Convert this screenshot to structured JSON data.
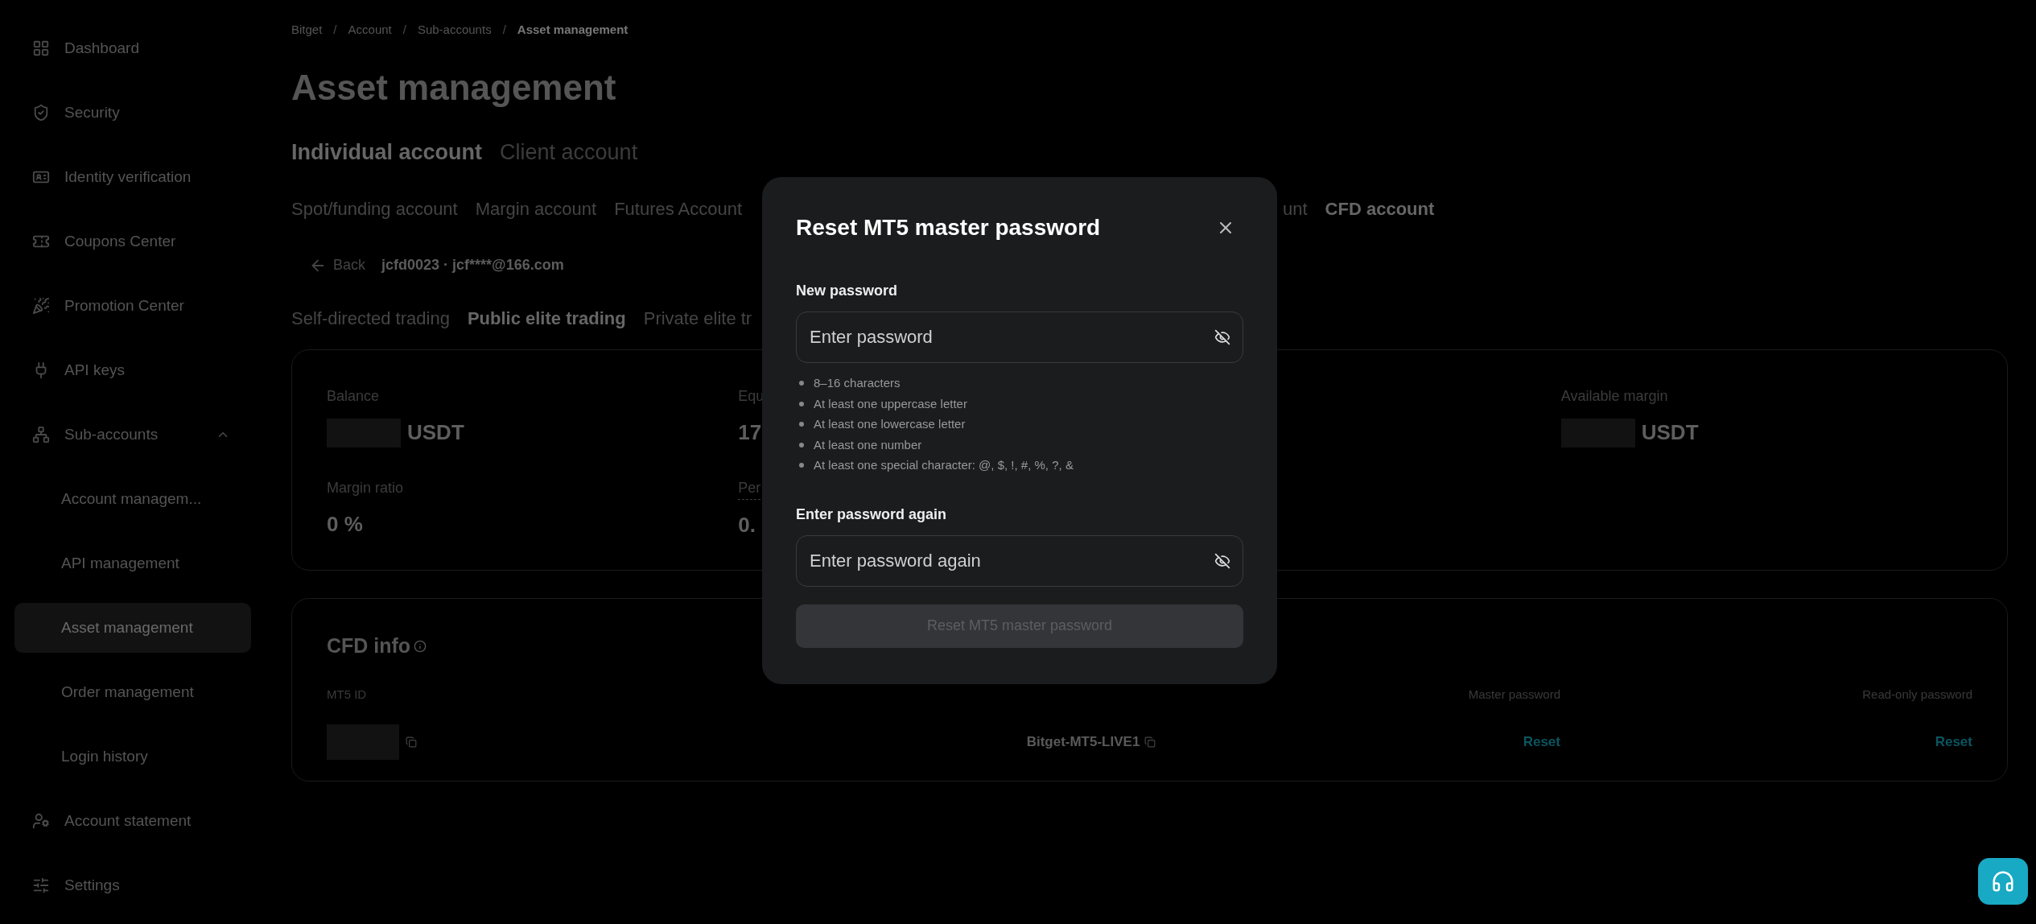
{
  "sidebar": {
    "items": [
      {
        "label": "Dashboard",
        "selected": false
      },
      {
        "label": "Security",
        "selected": false
      },
      {
        "label": "Identity verification",
        "selected": false
      },
      {
        "label": "Coupons Center",
        "selected": false
      },
      {
        "label": "Promotion Center",
        "selected": false
      },
      {
        "label": "API keys",
        "selected": false
      },
      {
        "label": "Sub-accounts",
        "selected": false,
        "expanded": true,
        "children": [
          {
            "label": "Account managem...",
            "selected": false
          },
          {
            "label": "API management",
            "selected": false
          },
          {
            "label": "Asset management",
            "selected": true
          },
          {
            "label": "Order management",
            "selected": false
          },
          {
            "label": "Login history",
            "selected": false
          }
        ]
      },
      {
        "label": "Account statement",
        "selected": false
      },
      {
        "label": "Settings",
        "selected": false
      }
    ]
  },
  "breadcrumb": [
    {
      "label": "Bitget",
      "current": false
    },
    {
      "label": "Account",
      "current": false
    },
    {
      "label": "Sub-accounts",
      "current": false
    },
    {
      "label": "Asset management",
      "current": true
    }
  ],
  "breadcrumb_separator": "/",
  "title": "Asset management",
  "account_tabs": [
    {
      "label": "Individual account",
      "selected": true
    },
    {
      "label": "Client account",
      "selected": false
    }
  ],
  "wallet_tabs": [
    {
      "label": "Spot/funding account",
      "selected": false
    },
    {
      "label": "Margin account",
      "selected": false
    },
    {
      "label": "Futures Account",
      "selected": false
    },
    {
      "label": "unt",
      "selected": false
    },
    {
      "label": "CFD account",
      "selected": true
    }
  ],
  "back": {
    "label": "Back",
    "account": "jcfd0023 · jcf****@166.com"
  },
  "trading_tabs": [
    {
      "label": "Self-directed trading",
      "selected": false
    },
    {
      "label": "Public elite trading",
      "selected": true
    },
    {
      "label": "Private elite tr",
      "selected": false
    }
  ],
  "metrics": [
    {
      "label": "Balance",
      "value": "USDT",
      "redacted": true
    },
    {
      "label": "Equ",
      "value": "17",
      "redacted": false
    },
    {
      "label": "Available margin",
      "value": "USDT",
      "redacted": true
    },
    {
      "label": "Margin ratio",
      "value": "0 %",
      "redacted": false
    },
    {
      "label": "Per",
      "value": "0.",
      "redacted": false
    }
  ],
  "cfd_info": {
    "title": "CFD info",
    "columns": [
      {
        "label": "MT5 ID"
      },
      {
        "label": "Master password"
      },
      {
        "label": "Read-only password"
      }
    ],
    "row": {
      "mt5_id": {
        "redacted": true
      },
      "server": "Bitget-MT5-LIVE1",
      "master_action": "Reset",
      "readonly_action": "Reset"
    }
  },
  "dialog": {
    "title": "Reset MT5 master password",
    "fields": [
      {
        "label": "New password",
        "placeholder": "Enter password"
      },
      {
        "label": "Enter password again",
        "placeholder": "Enter password again"
      }
    ],
    "rules": [
      "8–16 characters",
      "At least one uppercase letter",
      "At least one lowercase letter",
      "At least one number",
      "At least one special character: @, $, !, #, %, ?, &"
    ],
    "submit": {
      "label": "Reset MT5 master password",
      "disabled": true
    }
  }
}
